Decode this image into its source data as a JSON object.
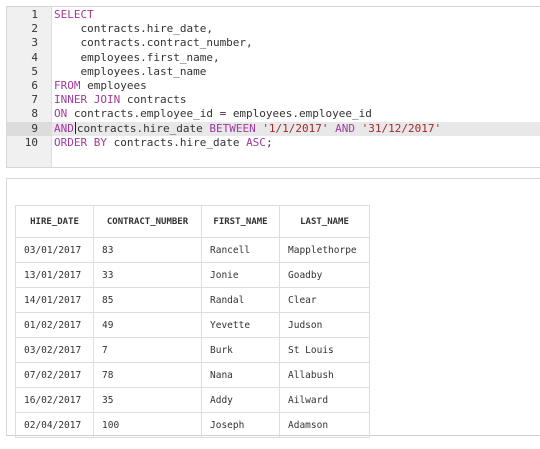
{
  "editor": {
    "lines": [
      {
        "n": "1",
        "parts": [
          {
            "t": "SELECT",
            "c": "kw"
          }
        ]
      },
      {
        "n": "2",
        "parts": [
          {
            "t": "    contracts.hire_date,",
            "c": ""
          }
        ]
      },
      {
        "n": "3",
        "parts": [
          {
            "t": "    contracts.contract_number,",
            "c": ""
          }
        ]
      },
      {
        "n": "4",
        "parts": [
          {
            "t": "    employees.first_name,",
            "c": ""
          }
        ]
      },
      {
        "n": "5",
        "parts": [
          {
            "t": "    employees.last_name",
            "c": ""
          }
        ]
      },
      {
        "n": "6",
        "parts": [
          {
            "t": "FROM",
            "c": "kw"
          },
          {
            "t": " employees",
            "c": ""
          }
        ]
      },
      {
        "n": "7",
        "parts": [
          {
            "t": "INNER JOIN",
            "c": "kw"
          },
          {
            "t": " contracts",
            "c": ""
          }
        ]
      },
      {
        "n": "8",
        "parts": [
          {
            "t": "ON",
            "c": "kw"
          },
          {
            "t": " contracts.employee_id = employees.employee_id",
            "c": ""
          }
        ]
      },
      {
        "n": "9",
        "active": true,
        "parts": [
          {
            "t": "AND",
            "c": "kw"
          },
          {
            "t": "|",
            "c": "cursor"
          },
          {
            "t": "contracts.hire_date ",
            "c": ""
          },
          {
            "t": "BETWEEN",
            "c": "kw"
          },
          {
            "t": " ",
            "c": ""
          },
          {
            "t": "'1/1/2017'",
            "c": "str"
          },
          {
            "t": " ",
            "c": ""
          },
          {
            "t": "AND",
            "c": "kw"
          },
          {
            "t": " ",
            "c": ""
          },
          {
            "t": "'31/12/2017'",
            "c": "str"
          }
        ]
      },
      {
        "n": "10",
        "parts": [
          {
            "t": "ORDER BY",
            "c": "kw"
          },
          {
            "t": " contracts.hire_date ",
            "c": ""
          },
          {
            "t": "ASC",
            "c": "kw"
          },
          {
            "t": ";",
            "c": ""
          }
        ]
      }
    ]
  },
  "results": {
    "headers": [
      "HIRE_DATE",
      "CONTRACT_NUMBER",
      "FIRST_NAME",
      "LAST_NAME"
    ],
    "rows": [
      [
        "03/01/2017",
        "83",
        "Rancell",
        "Mapplethorpe"
      ],
      [
        "13/01/2017",
        "33",
        "Jonie",
        "Goadby"
      ],
      [
        "14/01/2017",
        "85",
        "Randal",
        "Clear"
      ],
      [
        "01/02/2017",
        "49",
        "Yevette",
        "Judson"
      ],
      [
        "03/02/2017",
        "7",
        "Burk",
        "St Louis"
      ],
      [
        "07/02/2017",
        "78",
        "Nana",
        "Allabush"
      ],
      [
        "16/02/2017",
        "35",
        "Addy",
        "Ailward"
      ],
      [
        "02/04/2017",
        "100",
        "Joseph",
        "Adamson"
      ]
    ]
  },
  "colors": {
    "keyword": "#a0399e",
    "string": "#a02a2a"
  }
}
